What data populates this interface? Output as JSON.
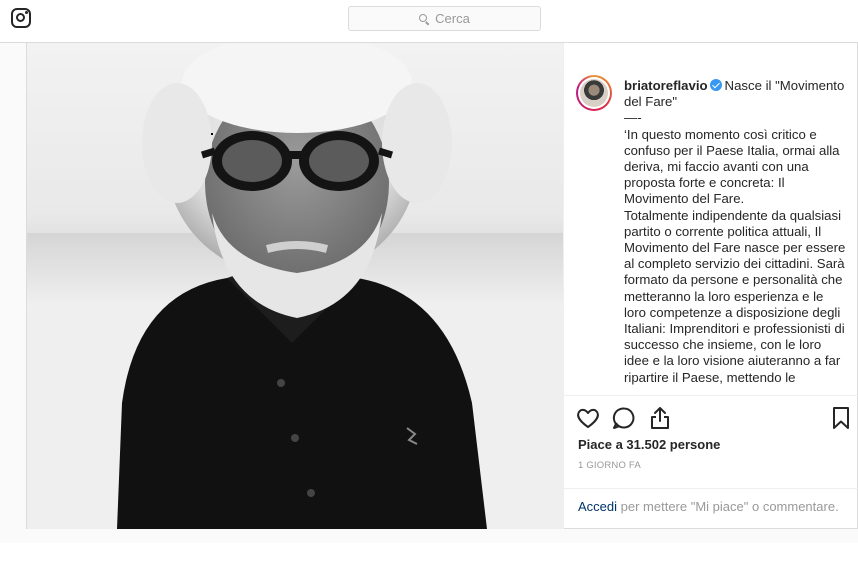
{
  "header": {
    "logo_icon": "instagram-glyph-icon",
    "search": {
      "placeholder": "Cerca",
      "icon": "search-icon"
    }
  },
  "post": {
    "author": {
      "username": "briatoreflavio",
      "verified": true
    },
    "caption": "Nasce il \"Movimento del Fare\"\n—-\n‘In questo momento così critico e confuso per il Paese Italia, ormai alla deriva, mi faccio avanti con una proposta forte e concreta: Il Movimento del Fare.\nTotalmente indipendente da qualsiasi partito o corrente politica attuali, Il Movimento del Fare nasce per essere al completo servizio dei cittadini. Sarà formato da persone e personalità che metteranno la loro esperienza e le loro competenze a disposizione degli Italiani: Imprenditori e professionisti di successo che insieme, con le loro idee e la loro visione aiuteranno a far ripartire il Paese, mettendo le",
    "actions": {
      "like_icon": "heart-icon",
      "comment_icon": "comment-bubble-icon",
      "share_icon": "share-icon",
      "save_icon": "bookmark-icon"
    },
    "likes_text": "Piace a 31.502 persone",
    "timestamp": "1 GIORNO FA",
    "login_prompt": {
      "link": "Accedi",
      "text": " per mettere \"Mi piace\" o commentare."
    }
  },
  "colors": {
    "border": "#dbdbdb",
    "verified_blue": "#3897f0",
    "link": "#003569",
    "muted": "#999999"
  }
}
